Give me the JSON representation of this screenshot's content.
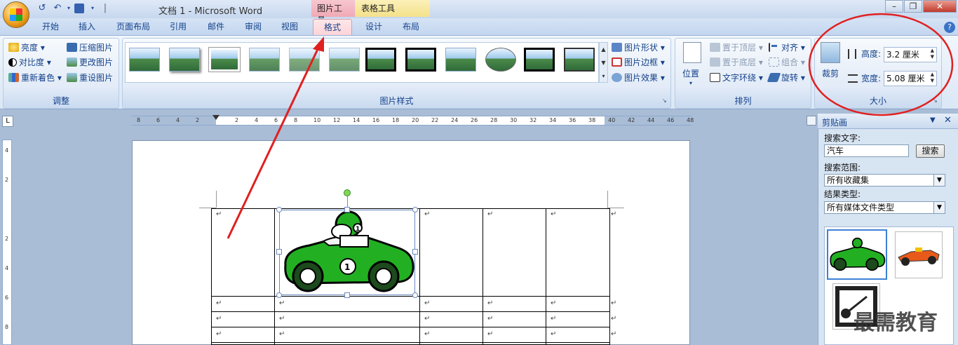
{
  "titlebar": {
    "title": "文档 1 - Microsoft Word",
    "context_tab_picture": "图片工具",
    "context_tab_table": "表格工具",
    "min": "–",
    "restore": "❐",
    "close": "✕"
  },
  "tabs": [
    "开始",
    "插入",
    "页面布局",
    "引用",
    "邮件",
    "审阅",
    "视图",
    "格式",
    "设计",
    "布局"
  ],
  "active_tab": "格式",
  "ribbon": {
    "adjust": {
      "label": "调整",
      "items": [
        "亮度",
        "对比度",
        "重新着色",
        "压缩图片",
        "更改图片",
        "重设图片"
      ]
    },
    "styles": {
      "label": "图片样式",
      "side": [
        "图片形状",
        "图片边框",
        "图片效果"
      ]
    },
    "arrange": {
      "label": "排列",
      "position": "位置",
      "items": [
        "置于顶层",
        "置于底层",
        "文字环绕",
        "对齐",
        "组合",
        "旋转"
      ]
    },
    "size": {
      "label": "大小",
      "crop": "裁剪",
      "height_label": "高度:",
      "height_value": "3.2 厘米",
      "width_label": "宽度:",
      "width_value": "5.08 厘米"
    }
  },
  "hruler_ticks": [
    "8",
    "6",
    "4",
    "2",
    "",
    "2",
    "4",
    "6",
    "8",
    "10",
    "12",
    "14",
    "16",
    "18",
    "20",
    "22",
    "24",
    "26",
    "28",
    "30",
    "32",
    "34",
    "36",
    "38",
    "40",
    "42",
    "44",
    "46",
    "48"
  ],
  "vruler_ticks": [
    "4",
    "2",
    "",
    "2",
    "4",
    "6",
    "8"
  ],
  "table": {
    "return_mark": "↵"
  },
  "clipart_pane": {
    "title": "剪贴画",
    "search_label": "搜索文字:",
    "search_value": "汽车",
    "search_button": "搜索",
    "scope_label": "搜索范围:",
    "scope_value": "所有收藏集",
    "type_label": "结果类型:",
    "type_value": "所有媒体文件类型"
  },
  "watermark": "最需教育",
  "colors": {
    "annotation_red": "#e02020",
    "active_tab": "#fbd3d8"
  }
}
